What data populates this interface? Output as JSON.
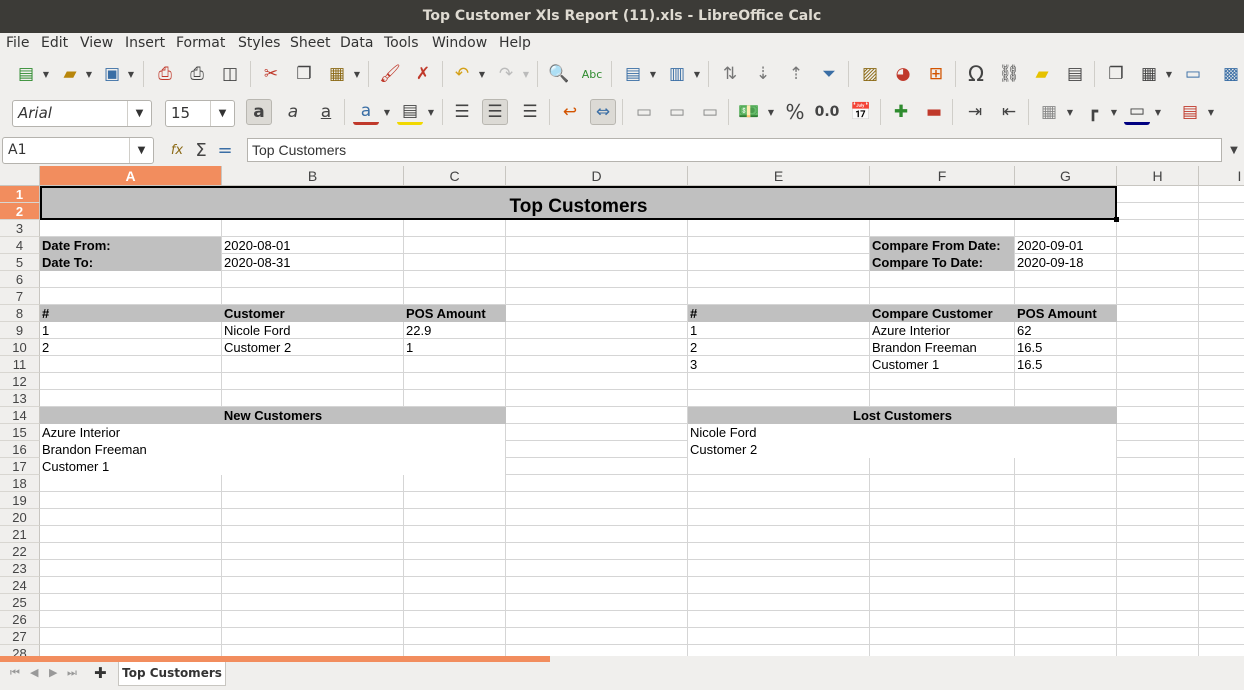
{
  "window": {
    "title": "Top Customer Xls Report (11).xls - LibreOffice Calc"
  },
  "menu": [
    "File",
    "Edit",
    "View",
    "Insert",
    "Format",
    "Styles",
    "Sheet",
    "Data",
    "Tools",
    "Window",
    "Help"
  ],
  "format_toolbar": {
    "font_name": "Arial",
    "font_size": "15",
    "percent_label": "%",
    "decimal_label": "0.0"
  },
  "formula_bar": {
    "cell_ref": "A1",
    "content": "Top Customers"
  },
  "columns": [
    "A",
    "B",
    "C",
    "D",
    "E",
    "F",
    "G",
    "H",
    "I"
  ],
  "rows": [
    "1",
    "2",
    "3",
    "4",
    "5",
    "6",
    "7",
    "8",
    "9",
    "10",
    "11",
    "12",
    "13",
    "14",
    "15",
    "16",
    "17",
    "18",
    "19",
    "20",
    "21",
    "22",
    "23",
    "24",
    "25",
    "26",
    "27",
    "28"
  ],
  "sheet": {
    "title": "Top Customers",
    "date_from_label": "Date From:",
    "date_from": "2020-08-01",
    "date_to_label": "Date To:",
    "date_to": "2020-08-31",
    "compare_from_label": "Compare From Date:",
    "compare_from": "2020-09-01",
    "compare_to_label": "Compare To Date:",
    "compare_to": "2020-09-18",
    "left_table": {
      "headers": [
        "#",
        "Customer",
        "POS Amount"
      ],
      "rows": [
        [
          "1",
          "Nicole Ford",
          "22.9"
        ],
        [
          "2",
          "Customer 2",
          "1"
        ]
      ]
    },
    "right_table": {
      "headers": [
        "#",
        "Compare Customer",
        "POS Amount"
      ],
      "rows": [
        [
          "1",
          "Azure Interior",
          "62"
        ],
        [
          "2",
          "Brandon Freeman",
          "16.5"
        ],
        [
          "3",
          "Customer 1",
          "16.5"
        ]
      ]
    },
    "new_customers": {
      "title": "New Customers",
      "items": [
        "Azure Interior",
        "Brandon Freeman",
        "Customer 1"
      ]
    },
    "lost_customers": {
      "title": "Lost Customers",
      "items": [
        "Nicole Ford",
        "Customer 2"
      ]
    }
  },
  "sheet_tab": "Top Customers",
  "colors": {
    "selection": "#f28d5e",
    "header_fill": "#c0c0c0",
    "titlebar": "#3c3b37"
  }
}
